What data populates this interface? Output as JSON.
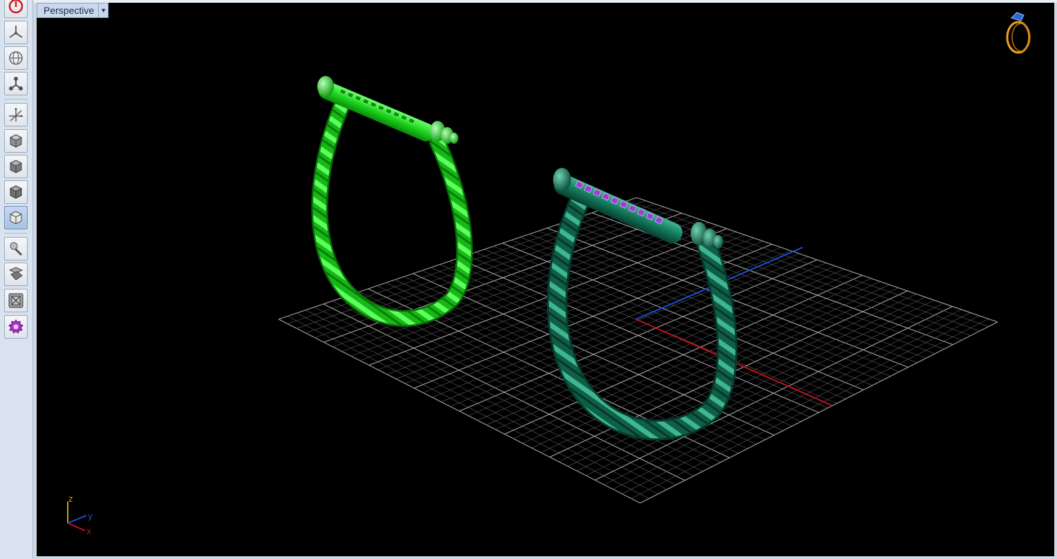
{
  "viewport": {
    "name": "Perspective",
    "dropdown_icon": "chevron-down-icon"
  },
  "toolbar": {
    "tools": [
      {
        "id": "power",
        "icon": "power-icon"
      },
      {
        "id": "pan",
        "icon": "pan-arrows-icon"
      },
      {
        "id": "rotate",
        "icon": "rotate-globe-icon"
      },
      {
        "id": "zoom",
        "icon": "connect-nodes-icon"
      },
      {
        "id": "move",
        "icon": "move-axes-icon"
      },
      {
        "id": "view-1",
        "icon": "shaded-cube-icon"
      },
      {
        "id": "view-2",
        "icon": "shaded-cube-icon"
      },
      {
        "id": "view-3",
        "icon": "shaded-cube-icon"
      },
      {
        "id": "view-4",
        "icon": "wireframe-cube-icon"
      },
      {
        "id": "render",
        "icon": "render-brush-icon"
      },
      {
        "id": "material",
        "icon": "material-icon"
      },
      {
        "id": "maximize",
        "icon": "maximize-icon"
      },
      {
        "id": "settings",
        "icon": "gear-icon"
      }
    ]
  },
  "axis_indicator": {
    "z": "z",
    "y": "y",
    "x": "x"
  },
  "colors": {
    "ring_left": "#1ed61e",
    "ring_right": "#137a5c",
    "stones": "#9b3fd6",
    "grid": "#7a7a7a",
    "axis_x": "#c0141b",
    "axis_y": "#1f4fd6",
    "logo": "#f0a21a"
  }
}
